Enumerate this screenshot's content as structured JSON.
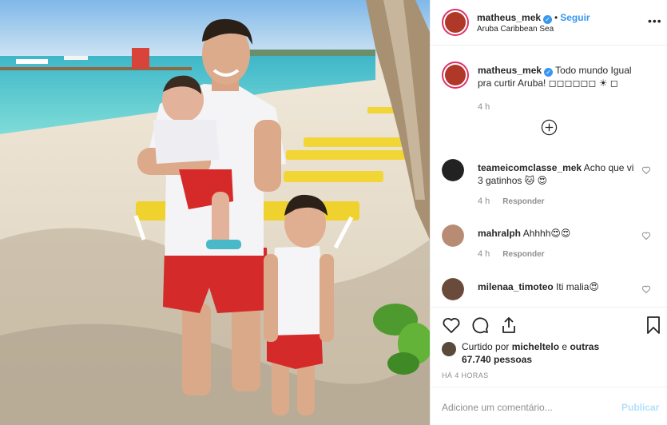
{
  "header": {
    "username": "matheus_mek",
    "follow_label": "Seguir",
    "separator": "•",
    "location": "Aruba Caribbean Sea",
    "more_label": "•••"
  },
  "caption": {
    "username": "matheus_mek",
    "text": "Todo mundo Igual pra curtir Aruba! ◻◻◻◻◻◻ ☀ ◻",
    "time": "4 h"
  },
  "comments": [
    {
      "username": "teameicomclasse_mek",
      "text": "Acho que vi 3 gatinhos 🐱 😍",
      "time": "4 h",
      "reply_label": "Responder"
    },
    {
      "username": "mahralph",
      "text": "Ahhhh😍😍",
      "time": "4 h",
      "reply_label": "Responder"
    },
    {
      "username": "milenaa_timoteo",
      "text": "Iti malia😍",
      "time": "",
      "reply_label": ""
    }
  ],
  "likes": {
    "prefix": "Curtido por",
    "user": "micheltelo",
    "middle": "e",
    "others": "outras 67.740 pessoas"
  },
  "posted_ago": "HÁ 4 HORAS",
  "add_comment": {
    "placeholder": "Adicione um comentário...",
    "publish_label": "Publicar"
  },
  "colors": {
    "link_blue": "#3897f0",
    "publish_disabled": "#b2dffc",
    "muted": "#8e8e8e"
  }
}
